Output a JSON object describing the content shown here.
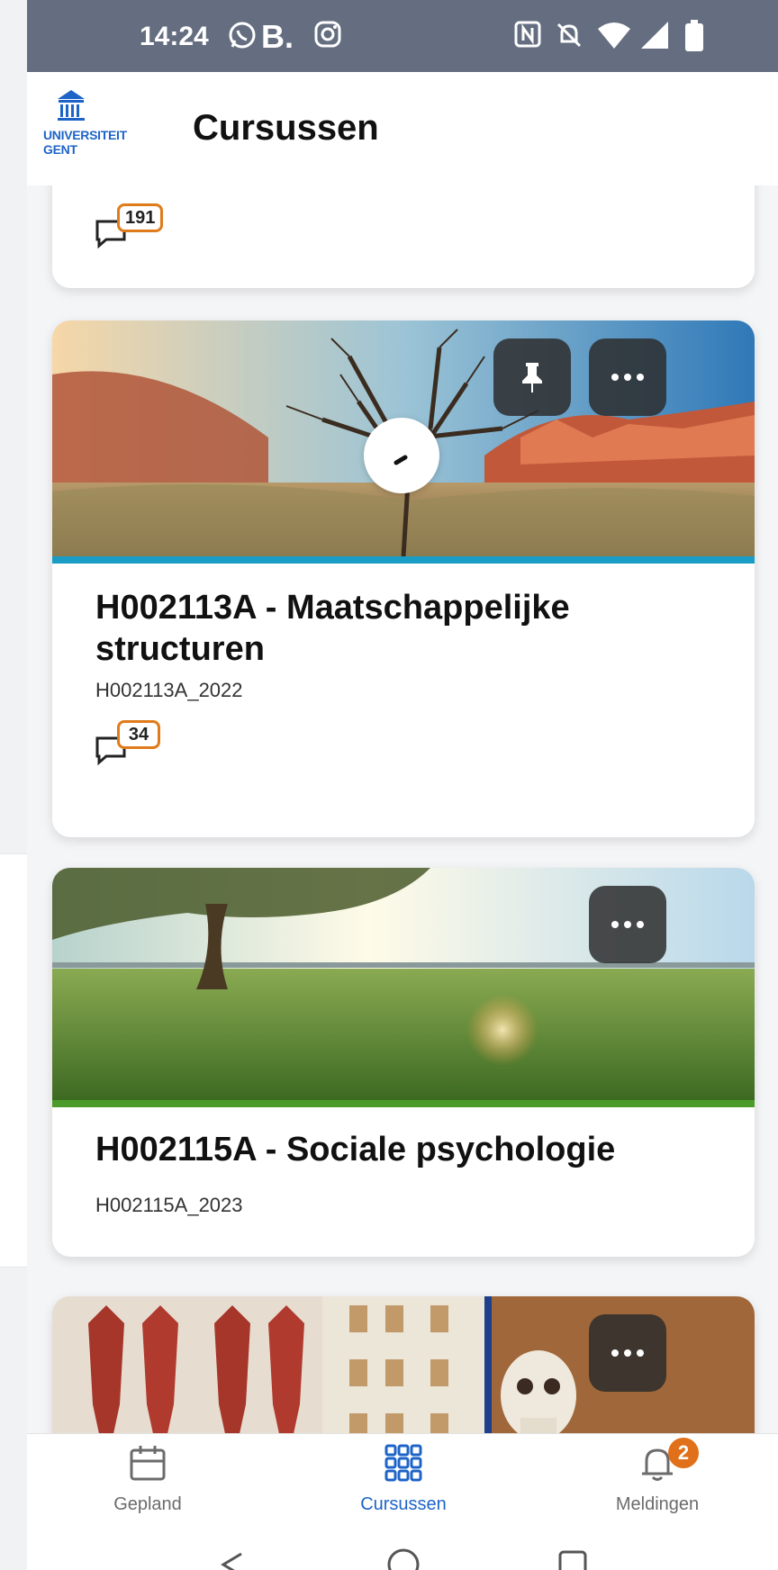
{
  "status_bar": {
    "time": "14:24",
    "app_letter": "B.",
    "icons": [
      "whatsapp-icon",
      "instagram-icon",
      "nfc-icon",
      "mute-icon",
      "wifi-icon",
      "signal-icon",
      "battery-icon"
    ]
  },
  "header": {
    "logo_text_line1": "UNIVERSITEIT",
    "logo_text_line2": "GENT",
    "title": "Cursussen"
  },
  "courses": [
    {
      "partial": true,
      "comment_count": "191"
    },
    {
      "title": "H002113A - Maatschappelijke structuren",
      "code": "H002113A_2022",
      "comment_count": "34",
      "pinned": true,
      "accent_color": "#1a9dc4"
    },
    {
      "title": "H002115A - Sociale psychologie",
      "code": "H002115A_2023",
      "accent_color": "#4a9b2a"
    },
    {
      "partial": true,
      "accent_color": "#1e3f8a"
    }
  ],
  "bottom_nav": {
    "items": [
      {
        "label": "Gepland",
        "icon": "calendar-icon",
        "active": false
      },
      {
        "label": "Cursussen",
        "icon": "grid-icon",
        "active": true
      },
      {
        "label": "Meldingen",
        "icon": "bell-icon",
        "active": false,
        "badge": "2"
      }
    ]
  },
  "colors": {
    "brand": "#1e64c8",
    "badge_orange": "#e07b1a",
    "status_bar": "#656e80"
  }
}
